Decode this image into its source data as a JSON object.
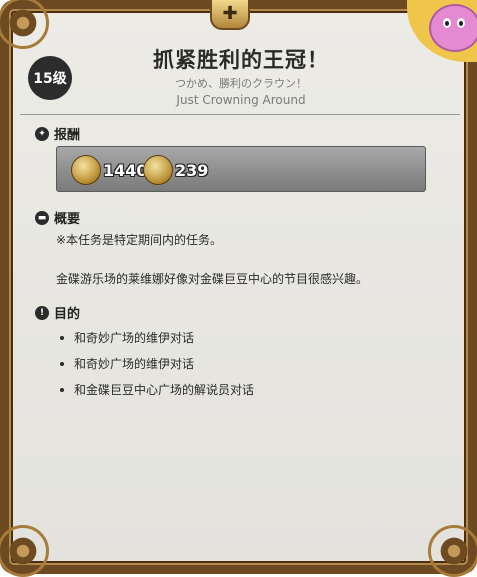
{
  "header": {
    "level_badge": "15级",
    "title": "抓紧胜利的王冠！",
    "subtitle_jp": "つかめ、勝利のクラウン！",
    "subtitle_en": "Just Crowning Around"
  },
  "rewards": {
    "label": "报酬",
    "items": [
      {
        "icon": "mgp-token-icon",
        "value": "1440"
      },
      {
        "icon": "gil-coin-icon",
        "value": "239"
      }
    ]
  },
  "overview": {
    "label": "概要",
    "line1": "※本任务是特定期间内的任务。",
    "line2": "金碟游乐场的莱维娜好像对金碟巨豆中心的节目很感兴趣。"
  },
  "objectives": {
    "label": "目的",
    "items": [
      "和奇妙广场的维伊对话",
      "和奇妙广场的维伊对话",
      "和金碟巨豆中心广场的解说员对话"
    ]
  },
  "colors": {
    "frame": "#6e4a22",
    "panel": "#e8e7e2",
    "reward_box": "#8e8e8e"
  }
}
